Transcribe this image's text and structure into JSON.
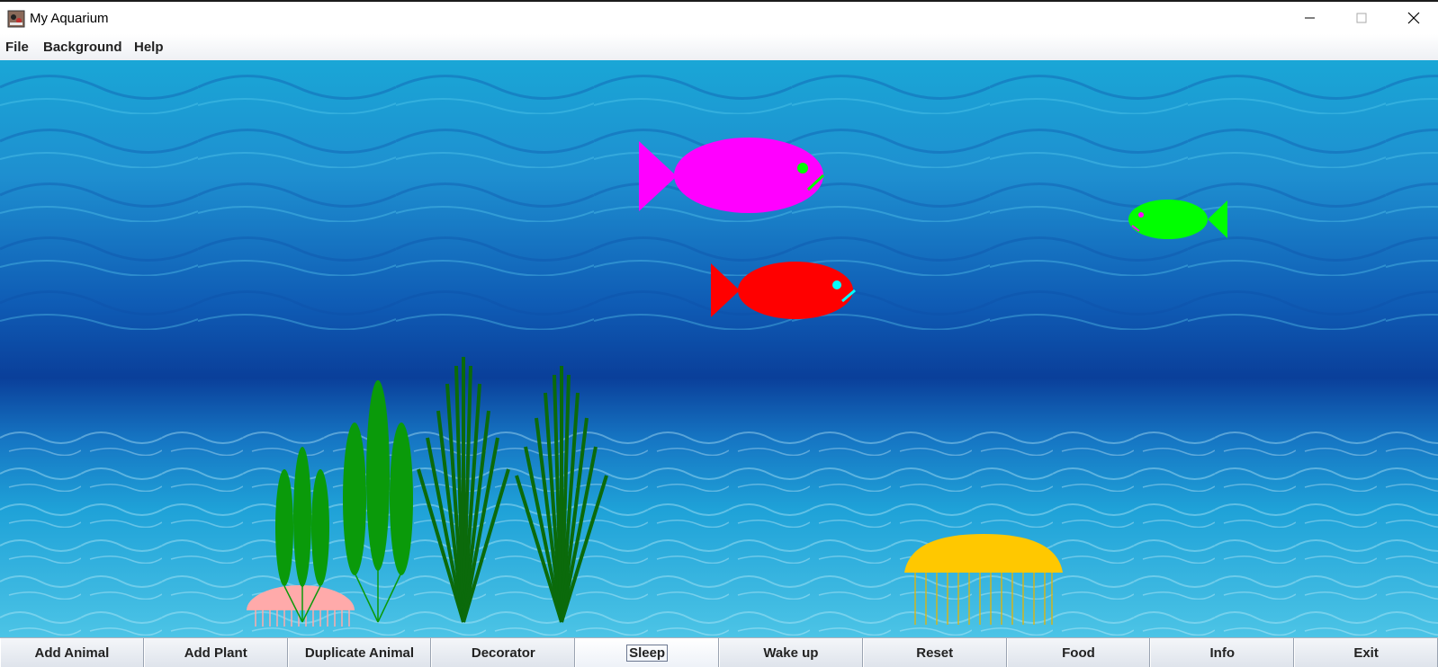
{
  "window": {
    "title": "My Aquarium",
    "controls": [
      "minimize",
      "maximize",
      "close"
    ]
  },
  "menu": {
    "items": [
      "File",
      "Background",
      "Help"
    ]
  },
  "scene": {
    "fish": [
      {
        "name": "magenta-fish",
        "body_color": "#ff00ff",
        "eye_color": "#00ff00",
        "facing": "right"
      },
      {
        "name": "red-fish",
        "body_color": "#ff0000",
        "eye_color": "#00ffff",
        "facing": "right"
      },
      {
        "name": "green-fish",
        "body_color": "#00ff00",
        "eye_color": "#ff00ff",
        "facing": "left"
      }
    ],
    "jellyfish": [
      {
        "name": "pink-jellyfish",
        "color": "#ffaaaa"
      },
      {
        "name": "yellow-jellyfish",
        "color": "#ffc800"
      }
    ],
    "plants": [
      {
        "name": "leaf-plant-small",
        "color": "#009900"
      },
      {
        "name": "leaf-plant-large",
        "color": "#009900"
      },
      {
        "name": "grass-plant-1",
        "color": "#006400"
      },
      {
        "name": "grass-plant-2",
        "color": "#006400"
      }
    ]
  },
  "toolbar": {
    "buttons": [
      {
        "label": "Add Animal"
      },
      {
        "label": "Add Plant"
      },
      {
        "label": "Duplicate Animal"
      },
      {
        "label": "Decorator"
      },
      {
        "label": "Sleep",
        "focused": true
      },
      {
        "label": "Wake up"
      },
      {
        "label": "Reset"
      },
      {
        "label": "Food"
      },
      {
        "label": "Info"
      },
      {
        "label": "Exit"
      }
    ]
  }
}
